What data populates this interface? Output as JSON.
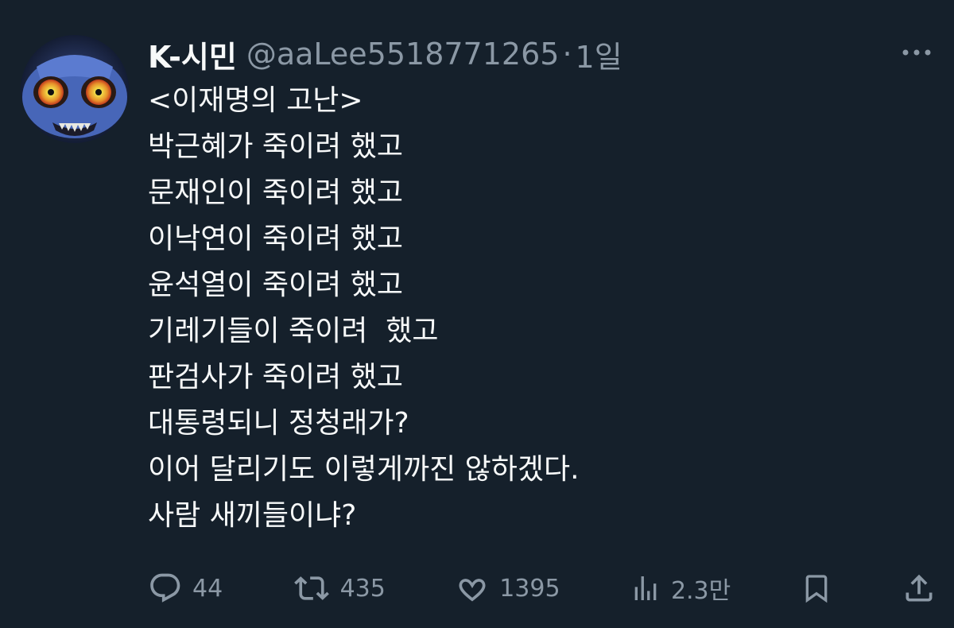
{
  "author": {
    "display_name": "K-시민",
    "handle": "@aaLee5518771265",
    "separator": "·",
    "time": "1일"
  },
  "tweet": {
    "lines": [
      "<이재명의 고난>",
      "박근혜가 죽이려 했고",
      "문재인이 죽이려 했고",
      "이낙연이 죽이려 했고",
      "윤석열이 죽이려 했고",
      "기레기들이 죽이려  했고",
      "판검사가 죽이려 했고",
      "대통령되니 정청래가?",
      "이어 달리기도 이렇게까진 않하겠다.",
      "사람 새끼들이냐?"
    ]
  },
  "actions": {
    "replies": "44",
    "retweets": "435",
    "likes": "1395",
    "views": "2.3만"
  },
  "icons": {
    "more": "more-icon",
    "reply": "reply-icon",
    "retweet": "retweet-icon",
    "like": "heart-icon",
    "views": "views-icon",
    "bookmark": "bookmark-icon",
    "share": "share-icon"
  },
  "colors": {
    "background": "#15202b",
    "text": "#f7f9f9",
    "secondary": "#8b98a5"
  }
}
